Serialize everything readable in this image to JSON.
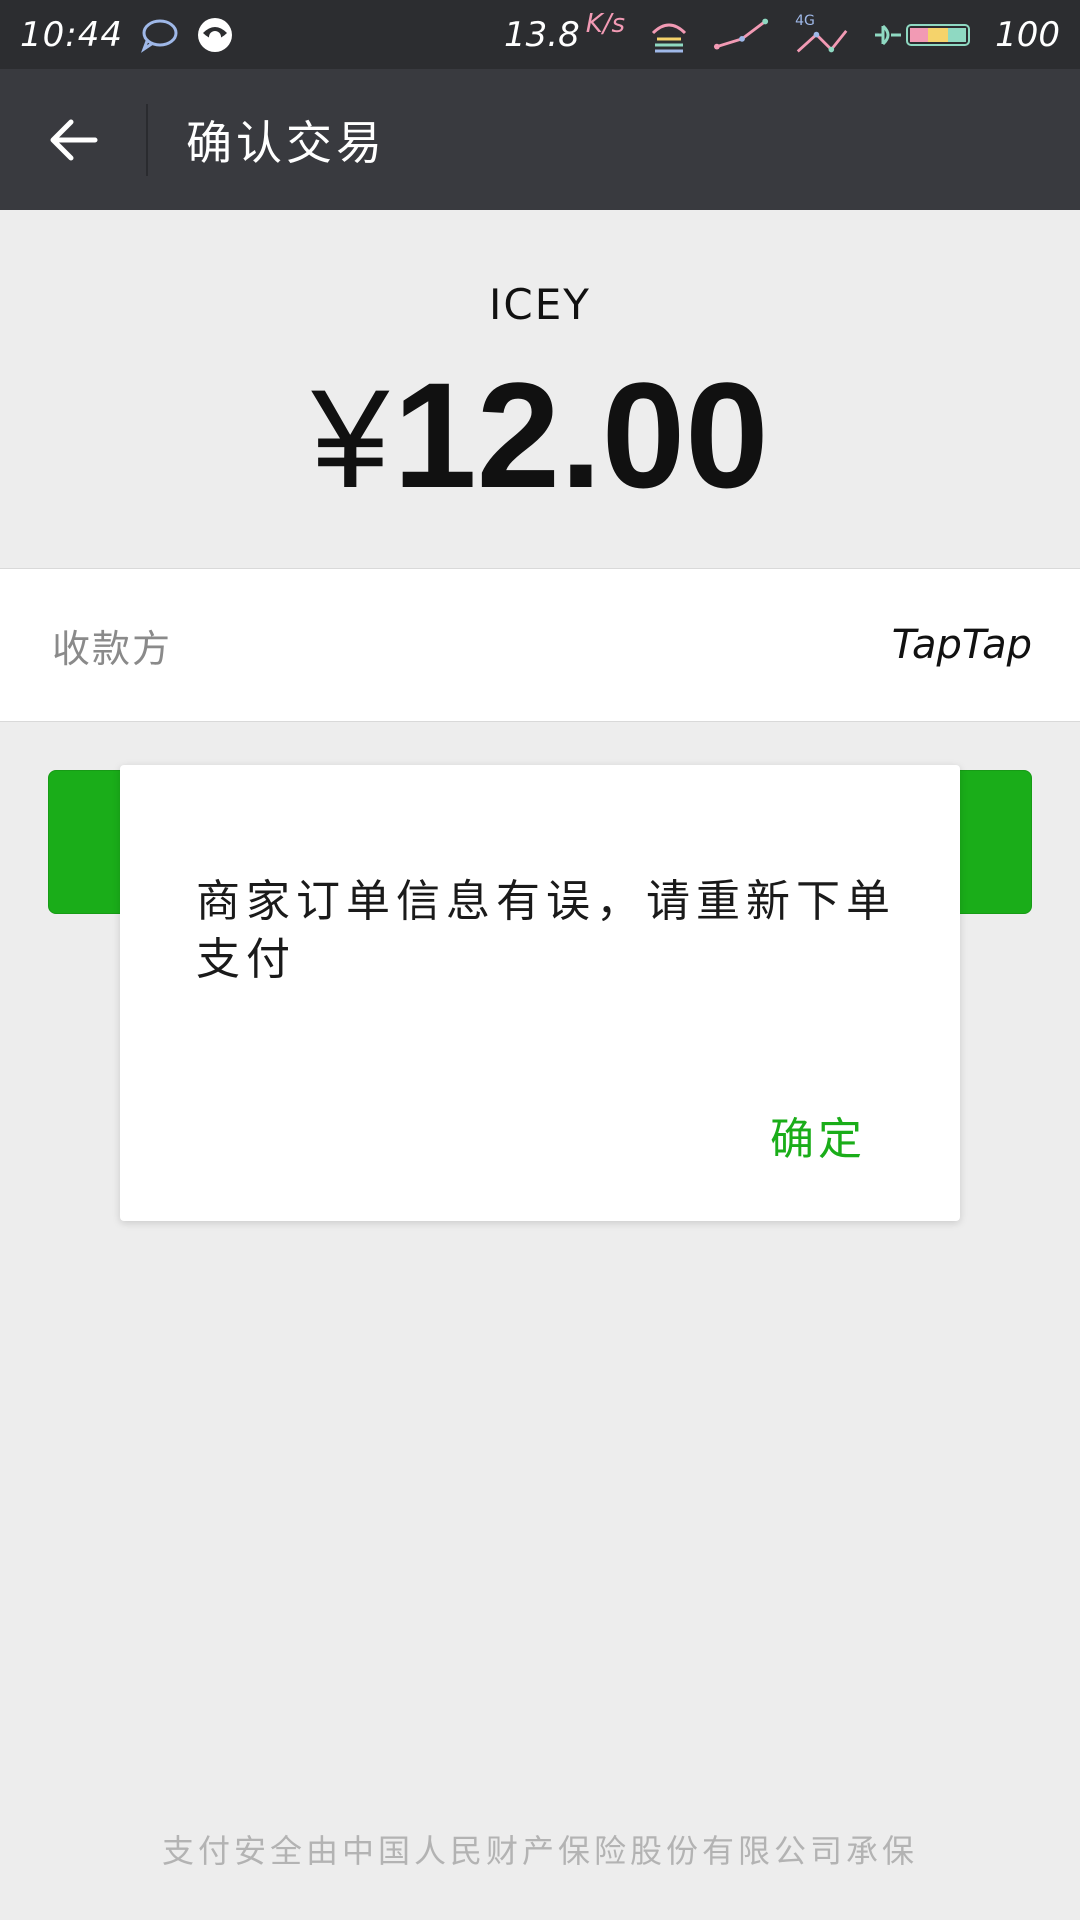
{
  "status_bar": {
    "time": "10:44",
    "net_speed": "13.8",
    "net_speed_unit": "K/s",
    "network_type": "4G",
    "battery": "100"
  },
  "header": {
    "title": "确认交易"
  },
  "order": {
    "product_name": "ICEY",
    "currency_symbol": "¥",
    "amount": "12.00"
  },
  "payee": {
    "label": "收款方",
    "value": "TapTap"
  },
  "dialog": {
    "message": "商家订单信息有误，请重新下单支付",
    "confirm_label": "确定"
  },
  "footer": {
    "note": "支付安全由中国人民财产保险股份有限公司承保"
  },
  "colors": {
    "accent_green": "#1aad19",
    "title_bar": "#393a3f",
    "status_bar": "#2c2d30",
    "background": "#ededed"
  }
}
